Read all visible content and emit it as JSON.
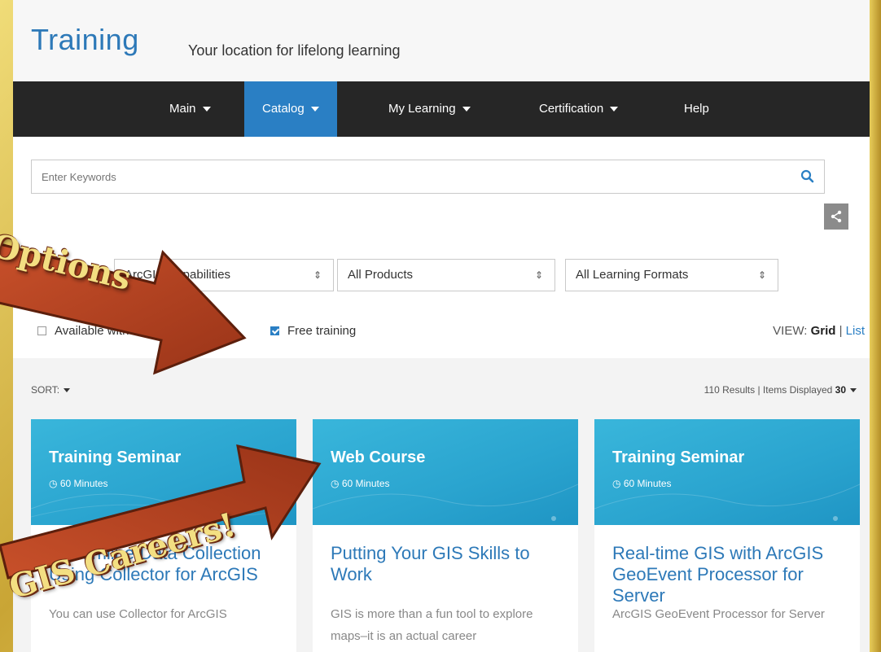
{
  "header": {
    "title": "Training",
    "tagline": "Your location for lifelong learning"
  },
  "nav": {
    "items": [
      {
        "label": "Main",
        "dropdown": true
      },
      {
        "label": "Catalog",
        "dropdown": true,
        "active": true
      },
      {
        "label": "My Learning",
        "dropdown": true
      },
      {
        "label": "Certification",
        "dropdown": true
      },
      {
        "label": "Help",
        "dropdown": false
      }
    ]
  },
  "search": {
    "placeholder": "Enter Keywords",
    "icon": "search-icon"
  },
  "share": {
    "icon": "share-icon"
  },
  "filters": {
    "capabilities": "ArcGIS Capabilities",
    "products": "All Products",
    "formats": "All Learning Formats",
    "available_label": "Available with Maintenance",
    "available_checked": false,
    "free_label": "Free training",
    "free_checked": true
  },
  "view": {
    "label": "VIEW:",
    "grid": "Grid",
    "separator": "|",
    "list": "List"
  },
  "results": {
    "sort_label": "SORT:",
    "count_text": "110 Results | Items Displayed",
    "items_displayed": "30"
  },
  "cards": [
    {
      "type": "Training Seminar",
      "duration": "60 Minutes",
      "title": "Streamline Data Collection Using Collector for ArcGIS",
      "description": "You can use Collector for ArcGIS"
    },
    {
      "type": "Web Course",
      "duration": "60 Minutes",
      "title": "Putting Your GIS Skills to Work",
      "description": "GIS is more than a fun tool to explore maps–it is an actual career"
    },
    {
      "type": "Training Seminar",
      "duration": "60 Minutes",
      "title": "Real-time GIS with ArcGIS GeoEvent Processor for Server",
      "description": "ArcGIS GeoEvent Processor for Server"
    }
  ],
  "overlays": {
    "arrow1_text": "Options",
    "arrow2_text": "GIS Careers!",
    "arrow_color": "#b5401f",
    "text_color": "#f3df82"
  }
}
